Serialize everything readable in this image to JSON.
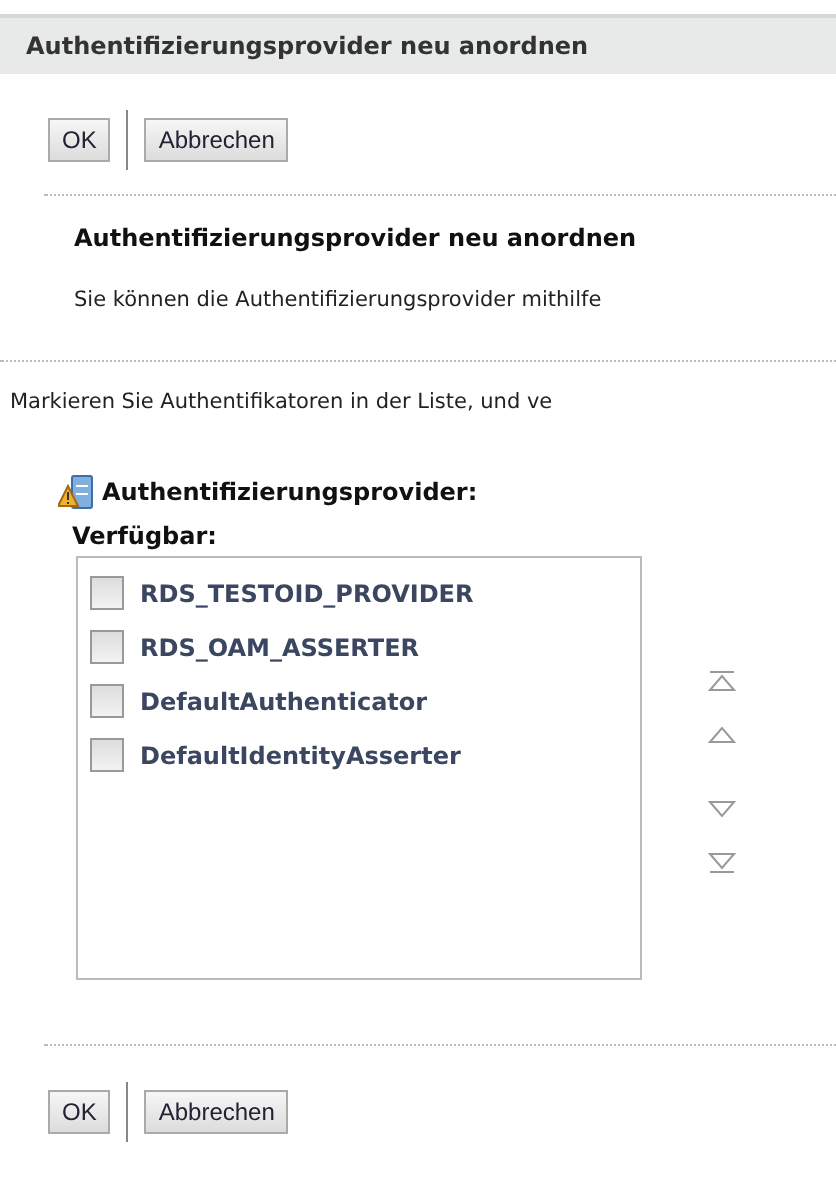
{
  "window": {
    "title": "Authentifizierungsprovider neu anordnen"
  },
  "top_buttons": [
    {
      "label": "OK"
    },
    {
      "label": "Abbrechen"
    }
  ],
  "heading": "Authentifizierungsprovider neu anordnen",
  "intro": "Sie können die Authentifizierungsprovider mithilfe",
  "instruction": "Markieren Sie Authentifikatoren in der Liste, und ve",
  "section": {
    "title": "Authentifizierungsprovider:",
    "list_label": "Verfügbar:",
    "items": [
      {
        "label": "RDS_TESTOID_PROVIDER",
        "checked": false
      },
      {
        "label": "RDS_OAM_ASSERTER",
        "checked": false
      },
      {
        "label": "DefaultAuthenticator",
        "checked": false
      },
      {
        "label": "DefaultIdentityAsserter",
        "checked": false
      }
    ]
  },
  "bottom_buttons": [
    {
      "label": "OK"
    },
    {
      "label": "Abbrechen"
    }
  ]
}
